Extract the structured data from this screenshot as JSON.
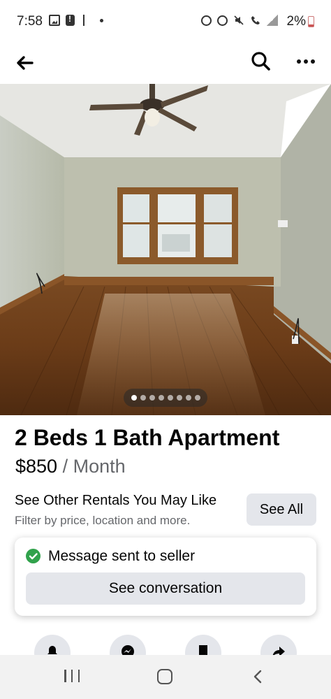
{
  "status_bar": {
    "time": "7:58",
    "battery": "2%",
    "left_icons": [
      "image-icon",
      "alert-icon",
      "usb-icon",
      "dot-icon"
    ],
    "right_icons": [
      "alarm-icon",
      "clock-icon",
      "mute-icon",
      "wifi-call-icon",
      "signal-icon",
      "battery-icon"
    ]
  },
  "header": {
    "back_icon": "arrow-left-icon",
    "search_icon": "search-icon",
    "more_icon": "more-horizontal-icon"
  },
  "photo": {
    "description_icon": "listing-photo",
    "dot_count": 8,
    "active_dot": 0
  },
  "listing": {
    "title": "2 Beds 1 Bath Apartment",
    "price": "$850",
    "price_unit": "/ Month"
  },
  "rentals": {
    "title": "See Other Rentals You May Like",
    "subtitle": "Filter by price, location and more.",
    "see_all_label": "See All"
  },
  "toast": {
    "message": "Message sent to seller",
    "button_label": "See conversation",
    "icon": "check-circle-icon",
    "accent_color": "#31a24c"
  },
  "actions": {
    "icons": [
      "bell-icon",
      "messenger-icon",
      "bookmark-icon",
      "share-icon"
    ]
  },
  "nav": {
    "icons": [
      "recents-icon",
      "home-icon",
      "back-chevron-icon"
    ]
  },
  "colors": {
    "primary_text": "#050505",
    "secondary_text": "#65676b",
    "button_bg": "#e4e6eb"
  }
}
